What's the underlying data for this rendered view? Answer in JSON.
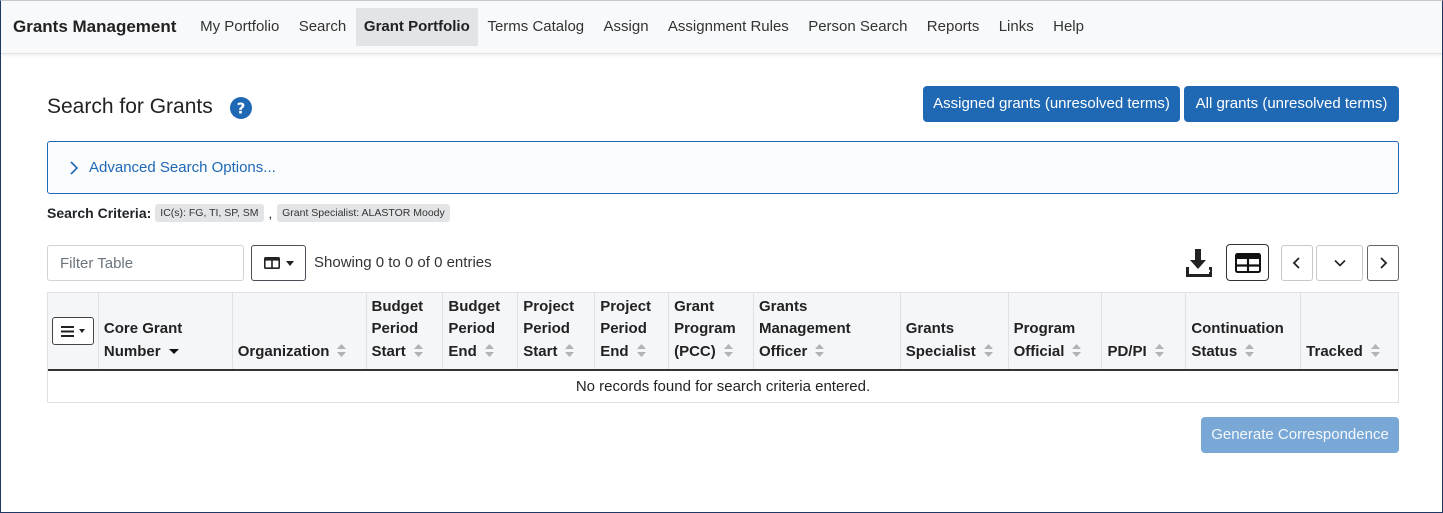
{
  "nav": {
    "brand": "Grants Management",
    "items": [
      {
        "label": "My Portfolio",
        "active": false
      },
      {
        "label": "Search",
        "active": false
      },
      {
        "label": "Grant Portfolio",
        "active": true
      },
      {
        "label": "Terms Catalog",
        "active": false
      },
      {
        "label": "Assign",
        "active": false
      },
      {
        "label": "Assignment Rules",
        "active": false
      },
      {
        "label": "Person Search",
        "active": false
      },
      {
        "label": "Reports",
        "active": false
      },
      {
        "label": "Links",
        "active": false
      },
      {
        "label": "Help",
        "active": false
      }
    ]
  },
  "header": {
    "title": "Search for Grants",
    "help_icon": "question-circle-icon",
    "btn_assigned": "Assigned grants (unresolved terms)",
    "btn_all": "All grants (unresolved terms)"
  },
  "advanced": {
    "label": "Advanced Search Options..."
  },
  "criteria": {
    "label": "Search Criteria:",
    "chips": [
      "IC(s): FG, TI, SP, SM",
      "Grant Specialist: ALASTOR Moody"
    ],
    "separator": ","
  },
  "toolbar": {
    "filter_placeholder": "Filter Table",
    "filter_value": "",
    "showing": "Showing 0 to 0 of 0 entries"
  },
  "table": {
    "columns": [
      "Core Grant Number",
      "Organization",
      "Budget Period Start",
      "Budget Period End",
      "Project Period Start",
      "Project Period End",
      "Grant Program (PCC)",
      "Grants Management Officer",
      "Grants Specialist",
      "Program Official",
      "PD/PI",
      "Continuation Status",
      "Tracked"
    ],
    "sorted_column": "Core Grant Number",
    "sort_direction": "desc",
    "empty_message": "No records found for search criteria entered."
  },
  "footer": {
    "generate_label": "Generate Correspondence"
  },
  "colors": {
    "primary": "#1f68b4",
    "disabled_primary": "#7aa8d6",
    "nav_bg": "#f8f9fa"
  }
}
